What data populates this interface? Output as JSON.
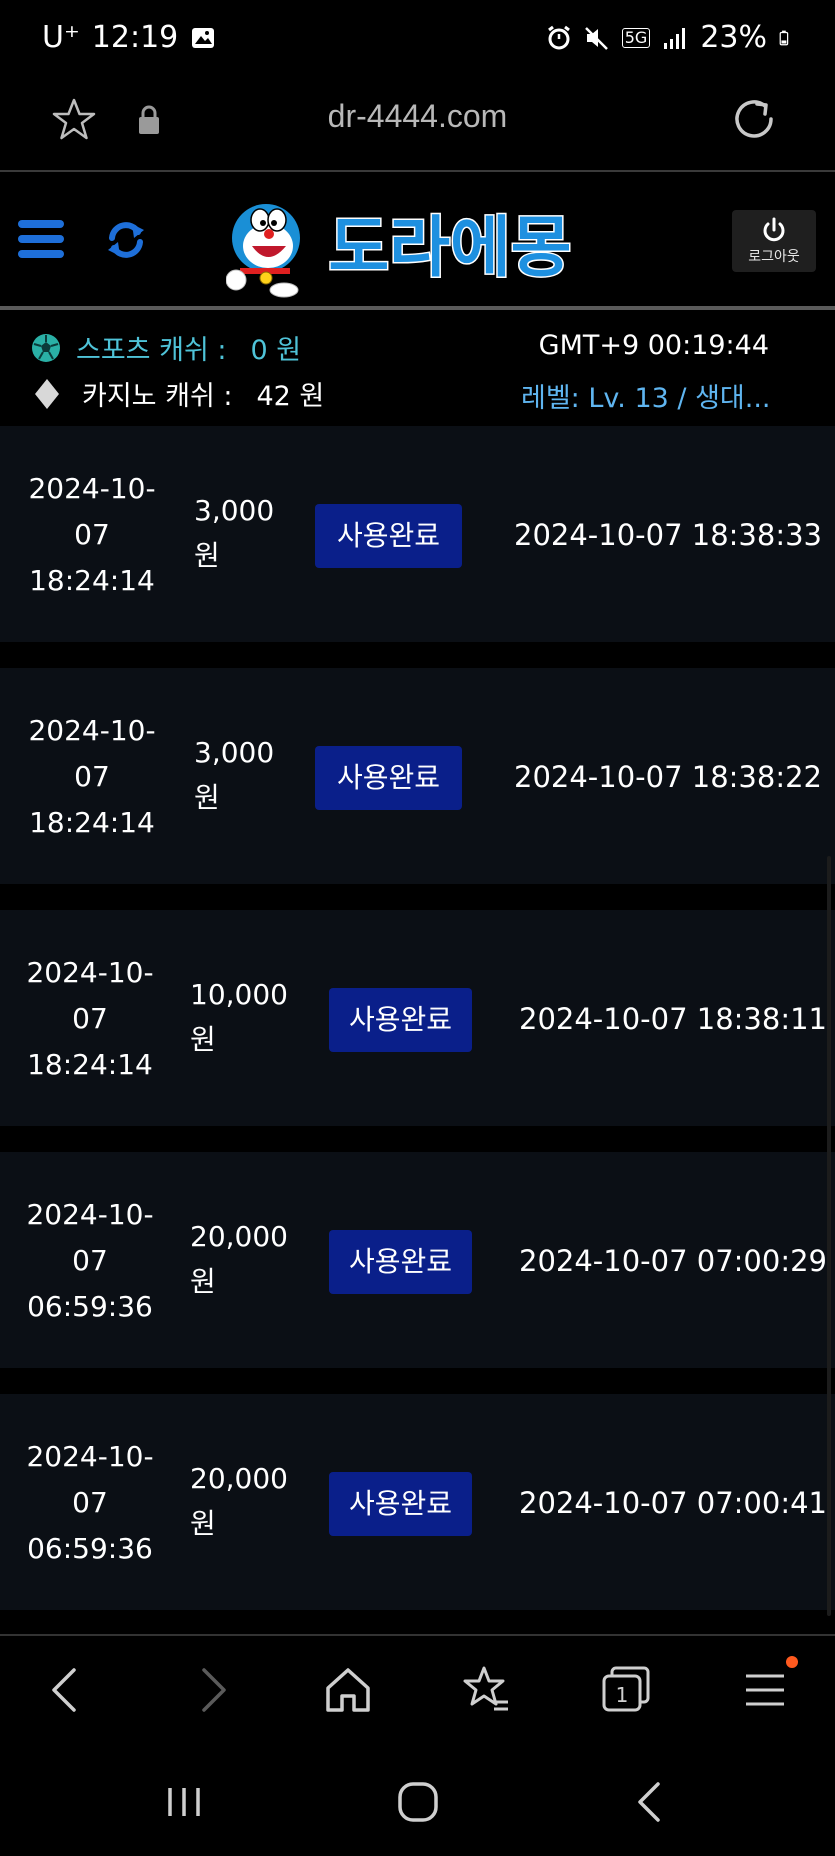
{
  "status_bar": {
    "carrier": "U⁺",
    "time": "12:19",
    "network": "5G",
    "battery": "23%"
  },
  "browser": {
    "url": "dr-4444.com"
  },
  "header": {
    "logo_text": "도라에몽",
    "logout_label": "로그아웃"
  },
  "info": {
    "sports_label": "스포츠 캐쉬 :",
    "sports_value": "0 원",
    "casino_label": "카지노 캐쉬 :",
    "casino_value": "42 원",
    "clock": "GMT+9 00:19:44",
    "level": "레벨: Lv. 13 / 생대..."
  },
  "list": {
    "rows": [
      {
        "date_line1": "2024-10-",
        "date_line2": "07",
        "date_line3": "18:24:14",
        "amount": "3,000",
        "unit": "원",
        "status": "사용완료",
        "used_at": "2024-10-07 18:38:33"
      },
      {
        "date_line1": "2024-10-",
        "date_line2": "07",
        "date_line3": "18:24:14",
        "amount": "3,000",
        "unit": "원",
        "status": "사용완료",
        "used_at": "2024-10-07 18:38:22"
      },
      {
        "date_line1": "2024-10-",
        "date_line2": "07",
        "date_line3": "18:24:14",
        "amount": "10,000",
        "unit": "원",
        "status": "사용완료",
        "used_at": "2024-10-07 18:38:11"
      },
      {
        "date_line1": "2024-10-",
        "date_line2": "07",
        "date_line3": "06:59:36",
        "amount": "20,000",
        "unit": "원",
        "status": "사용완료",
        "used_at": "2024-10-07 07:00:29"
      },
      {
        "date_line1": "2024-10-",
        "date_line2": "07",
        "date_line3": "06:59:36",
        "amount": "20,000",
        "unit": "원",
        "status": "사용완료",
        "used_at": "2024-10-07 07:00:41"
      }
    ]
  },
  "bottom_nav": {
    "icons": [
      "back-icon",
      "forward-icon",
      "home-icon",
      "bookmarks-icon",
      "tabs-icon",
      "menu-icon"
    ],
    "tab_count": "1"
  },
  "colors": {
    "accent_blue": "#1e6fd9",
    "badge_blue": "#0a1f8a",
    "sports_cyan": "#4fc3d8",
    "level_blue": "#5fb5f0",
    "row_bg": "#0b0f15"
  }
}
